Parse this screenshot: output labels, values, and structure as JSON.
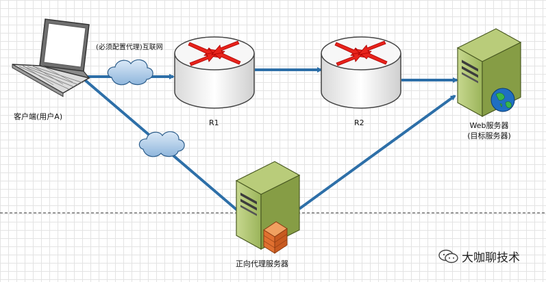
{
  "labels": {
    "internet": "(必须配置代理)互联网",
    "client": "客户端(用户A)",
    "r1": "R1",
    "r2": "R2",
    "web_line1": "Web服务器",
    "web_line2": "(目标服务器)",
    "proxy": "正向代理服务器"
  },
  "watermark": {
    "text": "大咖聊技术",
    "icon": "wechat-icon"
  },
  "colors": {
    "link": "#2d6fa8",
    "server_body": "#9bb45a",
    "router_body": "#ffffff",
    "arrow_red": "#e8231b",
    "grid": "#e3e3e3"
  }
}
